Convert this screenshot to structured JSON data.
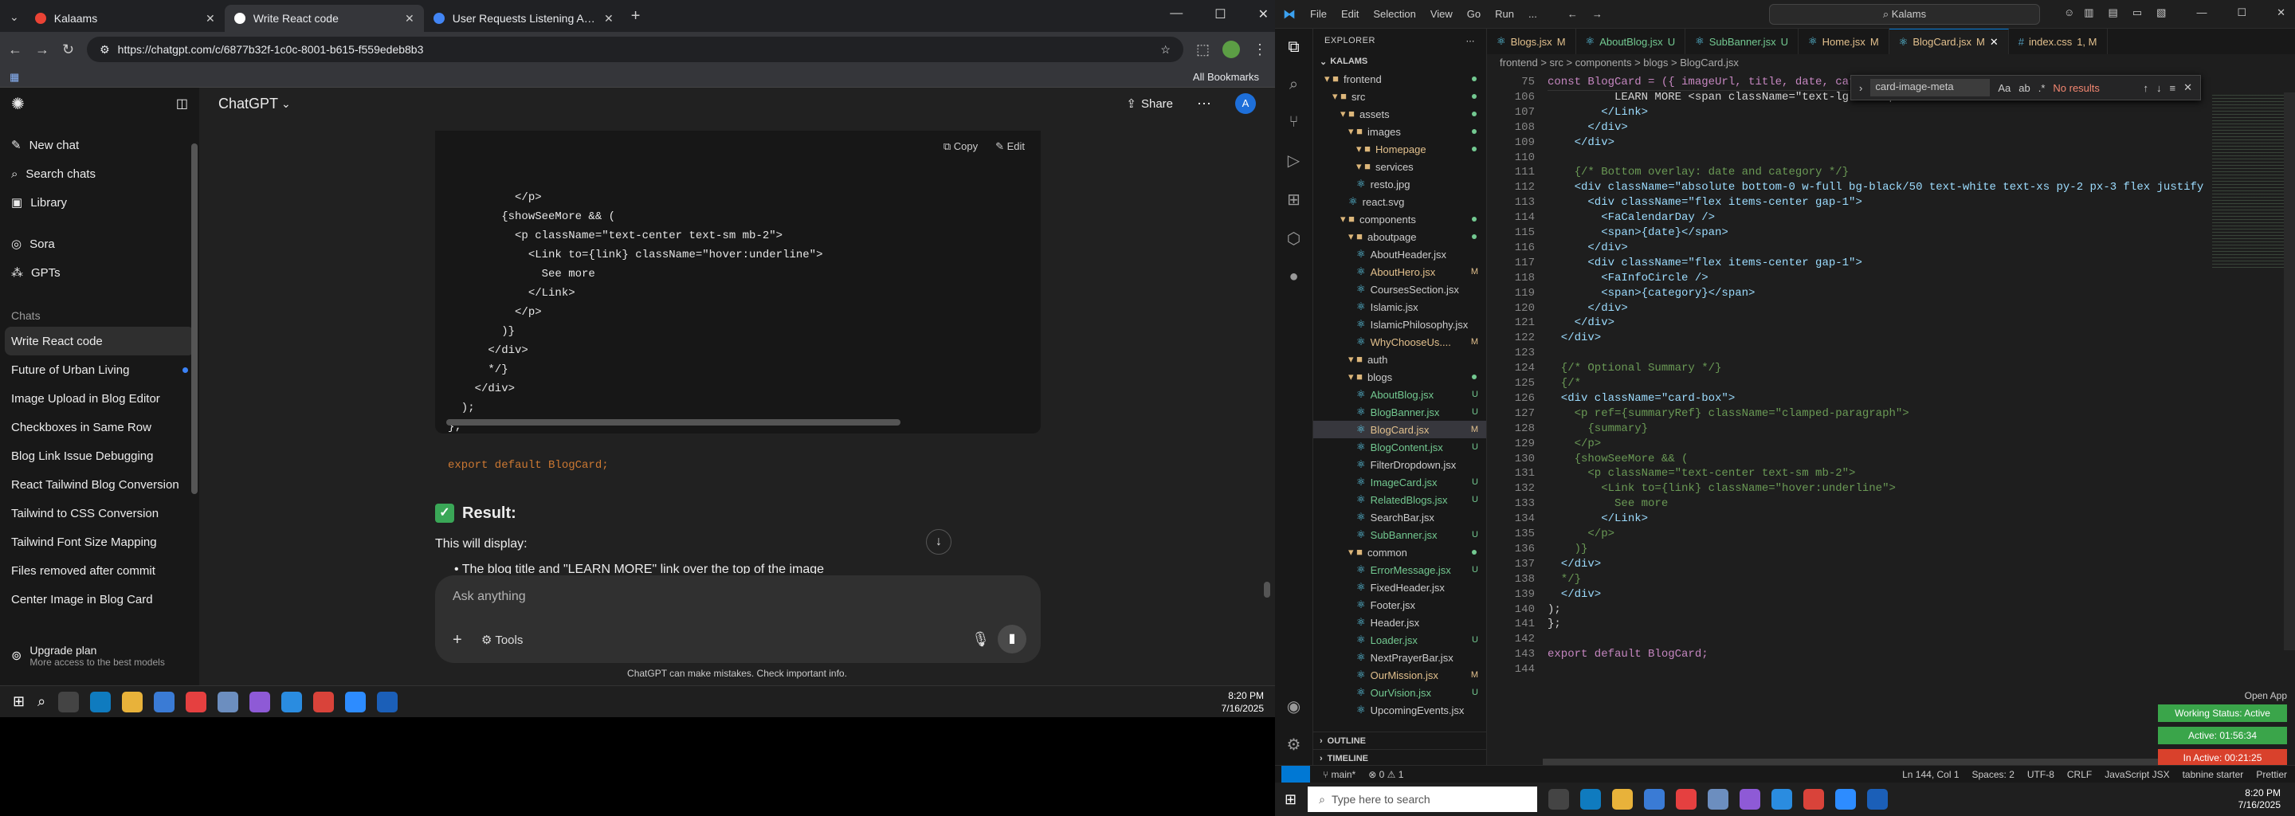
{
  "browser": {
    "tabs": [
      {
        "title": "Kalaams",
        "active": false
      },
      {
        "title": "Write React code",
        "active": true
      },
      {
        "title": "User Requests Listening Assista",
        "active": false
      }
    ],
    "url": "https://chatgpt.com/c/6877b32f-1c0c-8001-b615-f559edeb8b3",
    "all_bookmarks": "All Bookmarks"
  },
  "chatgpt": {
    "model": "ChatGPT",
    "share": "Share",
    "sidebar": {
      "new_chat": "New chat",
      "search": "Search chats",
      "library": "Library",
      "sora": "Sora",
      "gpts": "GPTs",
      "chats_header": "Chats",
      "chats": [
        "Write React code",
        "Future of Urban Living",
        "Image Upload in Blog Editor",
        "Checkboxes in Same Row",
        "Blog Link Issue Debugging",
        "React Tailwind Blog Conversion",
        "Tailwind to CSS Conversion",
        "Tailwind Font Size Mapping",
        "Files removed after commit",
        "Center Image in Blog Card"
      ],
      "upgrade": "Upgrade plan",
      "upgrade_sub": "More access to the best models"
    },
    "code_copy": "Copy",
    "code_edit": "Edit",
    "code_lines": [
      "          </p>",
      "        {showSeeMore && (",
      "          <p className=\"text-center text-sm mb-2\">",
      "            <Link to={link} className=\"hover:underline\">",
      "              See more",
      "            </Link>",
      "          </p>",
      "        )}",
      "      </div>",
      "      */}",
      "    </div>",
      "  );",
      "};",
      "",
      "export default BlogCard;"
    ],
    "result_label": "Result:",
    "display_text": "This will display:",
    "bullet_text": "The blog title and \"LEARN MORE\" link over the top of the image",
    "composer_placeholder": "Ask anything",
    "tools": "Tools",
    "disclaimer": "ChatGPT can make mistakes. Check important info."
  },
  "left_taskbar": {
    "time": "8:20 PM",
    "date": "7/16/2025"
  },
  "vscode": {
    "menu": [
      "File",
      "Edit",
      "Selection",
      "View",
      "Go",
      "Run",
      "..."
    ],
    "search": "Kalams",
    "explorer_title": "EXPLORER",
    "root": "KALAMS",
    "tree": [
      {
        "label": "frontend",
        "depth": 1,
        "type": "folder",
        "status": "dot"
      },
      {
        "label": "src",
        "depth": 2,
        "type": "folder",
        "status": "dot"
      },
      {
        "label": "assets",
        "depth": 3,
        "type": "folder",
        "status": "dot"
      },
      {
        "label": "images",
        "depth": 4,
        "type": "folder",
        "status": "dot"
      },
      {
        "label": "Homepage",
        "depth": 5,
        "type": "folder",
        "status": "dot",
        "color": "m"
      },
      {
        "label": "services",
        "depth": 5,
        "type": "folder",
        "status": ""
      },
      {
        "label": "resto.jpg",
        "depth": 5,
        "type": "file",
        "status": ""
      },
      {
        "label": "react.svg",
        "depth": 4,
        "type": "file",
        "status": ""
      },
      {
        "label": "components",
        "depth": 3,
        "type": "folder",
        "status": "dot"
      },
      {
        "label": "aboutpage",
        "depth": 4,
        "type": "folder",
        "status": "dot"
      },
      {
        "label": "AboutHeader.jsx",
        "depth": 5,
        "type": "file",
        "status": ""
      },
      {
        "label": "AboutHero.jsx",
        "depth": 5,
        "type": "file",
        "status": "M",
        "color": "m"
      },
      {
        "label": "CoursesSection.jsx",
        "depth": 5,
        "type": "file",
        "status": ""
      },
      {
        "label": "Islamic.jsx",
        "depth": 5,
        "type": "file",
        "status": ""
      },
      {
        "label": "IslamicPhilosophy.jsx",
        "depth": 5,
        "type": "file",
        "status": ""
      },
      {
        "label": "WhyChooseUs....",
        "depth": 5,
        "type": "file",
        "status": "M",
        "color": "m"
      },
      {
        "label": "auth",
        "depth": 4,
        "type": "folder",
        "status": ""
      },
      {
        "label": "blogs",
        "depth": 4,
        "type": "folder",
        "status": "dot"
      },
      {
        "label": "AboutBlog.jsx",
        "depth": 5,
        "type": "file",
        "status": "U",
        "color": "u"
      },
      {
        "label": "BlogBanner.jsx",
        "depth": 5,
        "type": "file",
        "status": "U",
        "color": "u"
      },
      {
        "label": "BlogCard.jsx",
        "depth": 5,
        "type": "file",
        "status": "M",
        "color": "m",
        "selected": true
      },
      {
        "label": "BlogContent.jsx",
        "depth": 5,
        "type": "file",
        "status": "U",
        "color": "u"
      },
      {
        "label": "FilterDropdown.jsx",
        "depth": 5,
        "type": "file",
        "status": ""
      },
      {
        "label": "ImageCard.jsx",
        "depth": 5,
        "type": "file",
        "status": "U",
        "color": "u"
      },
      {
        "label": "RelatedBlogs.jsx",
        "depth": 5,
        "type": "file",
        "status": "U",
        "color": "u"
      },
      {
        "label": "SearchBar.jsx",
        "depth": 5,
        "type": "file",
        "status": ""
      },
      {
        "label": "SubBanner.jsx",
        "depth": 5,
        "type": "file",
        "status": "U",
        "color": "u"
      },
      {
        "label": "common",
        "depth": 4,
        "type": "folder",
        "status": "dot"
      },
      {
        "label": "ErrorMessage.jsx",
        "depth": 5,
        "type": "file",
        "status": "U",
        "color": "u"
      },
      {
        "label": "FixedHeader.jsx",
        "depth": 5,
        "type": "file",
        "status": ""
      },
      {
        "label": "Footer.jsx",
        "depth": 5,
        "type": "file",
        "status": ""
      },
      {
        "label": "Header.jsx",
        "depth": 5,
        "type": "file",
        "status": ""
      },
      {
        "label": "Loader.jsx",
        "depth": 5,
        "type": "file",
        "status": "U",
        "color": "u"
      },
      {
        "label": "NextPrayerBar.jsx",
        "depth": 5,
        "type": "file",
        "status": ""
      },
      {
        "label": "OurMission.jsx",
        "depth": 5,
        "type": "file",
        "status": "M",
        "color": "m"
      },
      {
        "label": "OurVision.jsx",
        "depth": 5,
        "type": "file",
        "status": "U",
        "color": "u"
      },
      {
        "label": "UpcomingEvents.jsx",
        "depth": 5,
        "type": "file",
        "status": ""
      }
    ],
    "outline": "OUTLINE",
    "timeline": "TIMELINE",
    "editor_tabs": [
      {
        "label": "Blogs.jsx",
        "status": "M"
      },
      {
        "label": "AboutBlog.jsx",
        "status": "U"
      },
      {
        "label": "SubBanner.jsx",
        "status": "U"
      },
      {
        "label": "Home.jsx",
        "status": "M"
      },
      {
        "label": "BlogCard.jsx",
        "status": "M",
        "active": true
      },
      {
        "label": "index.css",
        "status": "1, M"
      }
    ],
    "breadcrumb": "frontend > src > components > blogs > BlogCard.jsx",
    "sticky_line": "const BlogCard = ({ imageUrl, title, date, categor",
    "find_value": "card-image-meta",
    "find_result": "No results",
    "line_numbers": [
      "75",
      "106",
      "107",
      "108",
      "109",
      "110",
      "111",
      "112",
      "113",
      "114",
      "115",
      "116",
      "117",
      "118",
      "119",
      "120",
      "121",
      "122",
      "123",
      "124",
      "125",
      "126",
      "127",
      "128",
      "129",
      "130",
      "131",
      "132",
      "133",
      "134",
      "135",
      "136",
      "137",
      "138",
      "139",
      "140",
      "141",
      "142",
      "143",
      "144"
    ],
    "code": [
      "const BlogCard = ({ imageUrl, title, date, categor",
      "          LEARN MORE <span className=\"text-lg\">→</span>",
      "        </Link>",
      "      </div>",
      "    </div>",
      "",
      "    {/* Bottom overlay: date and category */}",
      "    <div className=\"absolute bottom-0 w-full bg-black/50 text-white text-xs py-2 px-3 flex justify",
      "      <div className=\"flex items-center gap-1\">",
      "        <FaCalendarDay />",
      "        <span>{date}</span>",
      "      </div>",
      "      <div className=\"flex items-center gap-1\">",
      "        <FaInfoCircle />",
      "        <span>{category}</span>",
      "      </div>",
      "    </div>",
      "  </div>",
      "",
      "  {/* Optional Summary */}",
      "  {/*",
      "  <div className=\"card-box\">",
      "    <p ref={summaryRef} className=\"clamped-paragraph\">",
      "      {summary}",
      "    </p>",
      "    {showSeeMore && (",
      "      <p className=\"text-center text-sm mb-2\">",
      "        <Link to={link} className=\"hover:underline\">",
      "          See more",
      "        </Link>",
      "      </p>",
      "    )}",
      "  </div>",
      "  */}",
      "  </div>",
      ");",
      "};",
      "",
      "export default BlogCard;",
      ""
    ],
    "status": {
      "branch": "main*",
      "problems": "0 ⚠ 1",
      "position": "Ln 144, Col 1",
      "spaces": "Spaces: 2",
      "encoding": "UTF-8",
      "eol": "CRLF",
      "lang": "JavaScript JSX",
      "tabnine": "tabnine starter",
      "prettier": "Prettier"
    },
    "open_app": "Open App",
    "working_status": "Working Status: Active",
    "active_time": "Active: 01:56:34",
    "inactive_time": "In Active: 00:21:25"
  },
  "win_taskbar": {
    "search": "Type here to search",
    "time": "8:20 PM",
    "date": "7/16/2025"
  }
}
